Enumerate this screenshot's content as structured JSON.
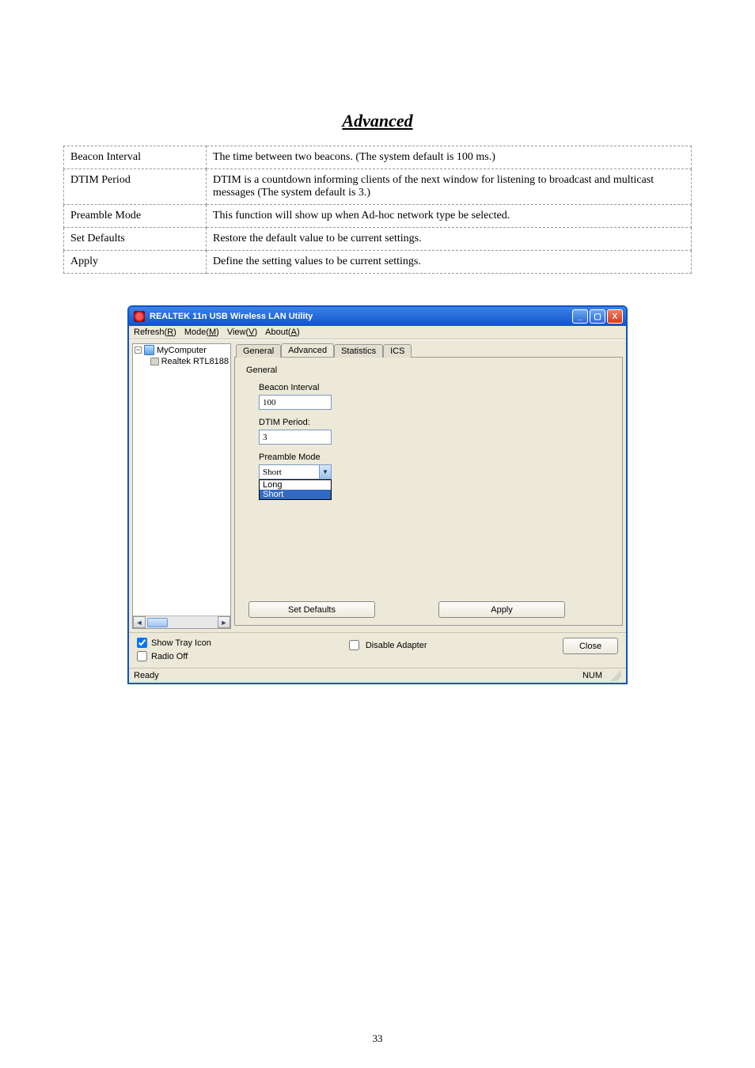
{
  "page_number": "33",
  "heading": "Advanced",
  "table": {
    "rows": [
      {
        "term": "Beacon Interval",
        "desc": "The time between two beacons. (The system default is 100 ms.)"
      },
      {
        "term": "DTIM Period",
        "desc": "DTIM is a countdown informing clients of the next window for listening to broadcast and multicast messages (The system default is 3.)"
      },
      {
        "term": "Preamble Mode",
        "desc": "This function will show up when Ad-hoc network type be selected."
      },
      {
        "term": "Set Defaults",
        "desc": "Restore the default value to be current settings."
      },
      {
        "term": "Apply",
        "desc": "Define the setting values to be current settings."
      }
    ]
  },
  "window": {
    "title": "REALTEK 11n USB Wireless LAN Utility",
    "menus": [
      {
        "label": "Refresh(",
        "hotkey": "R",
        "suffix": ")"
      },
      {
        "label": "Mode(",
        "hotkey": "M",
        "suffix": ")"
      },
      {
        "label": "View(",
        "hotkey": "V",
        "suffix": ")"
      },
      {
        "label": "About(",
        "hotkey": "A",
        "suffix": ")"
      }
    ],
    "tree": {
      "root": "MyComputer",
      "child": "Realtek RTL8188"
    },
    "tabs": [
      "General",
      "Advanced",
      "Statistics",
      "ICS"
    ],
    "active_tab": "Advanced",
    "group_label": "General",
    "fields": {
      "beacon": {
        "label": "Beacon Interval",
        "value": "100"
      },
      "dtim": {
        "label": "DTIM Period:",
        "value": "3"
      },
      "preamble": {
        "label": "Preamble Mode",
        "value": "Short",
        "options": [
          "Long",
          "Short"
        ],
        "highlight": "Short"
      }
    },
    "buttons": {
      "defaults": "Set Defaults",
      "apply": "Apply"
    },
    "checks": {
      "show_tray": {
        "label": "Show Tray Icon",
        "checked": true
      },
      "radio_off": {
        "label": "Radio Off",
        "checked": false
      },
      "disable_adapter": {
        "label": "Disable Adapter",
        "checked": false
      }
    },
    "close": "Close",
    "status": {
      "ready": "Ready",
      "num": "NUM"
    }
  }
}
